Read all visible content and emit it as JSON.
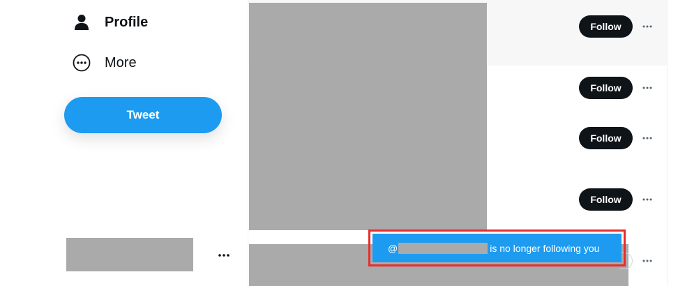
{
  "sidebar": {
    "items": [
      {
        "label": "Profile",
        "icon": "person-icon",
        "active": true
      },
      {
        "label": "More",
        "icon": "more-circle-icon",
        "active": false
      }
    ],
    "tweet_button": "Tweet"
  },
  "suggestions": {
    "follow_label": "Follow",
    "rows": 4
  },
  "toast": {
    "prefix": "@",
    "message": "is no longer following you"
  },
  "colors": {
    "accent": "#1d9bf0",
    "follow_bg": "#0f1419",
    "highlight": "#e92c2c",
    "redaction": "#aaaaaa"
  }
}
